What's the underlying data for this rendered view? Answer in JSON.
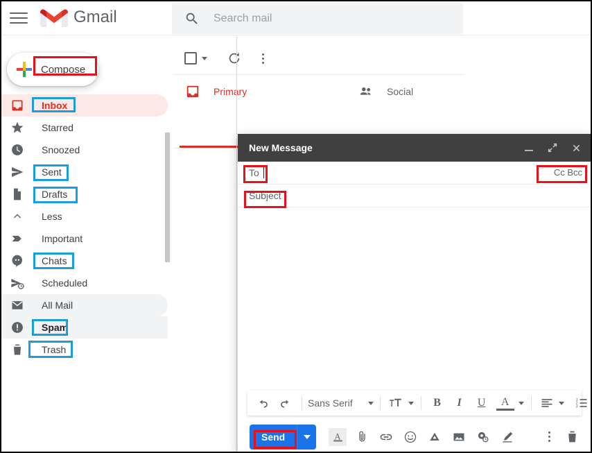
{
  "app": {
    "name": "Gmail",
    "menu_icon": "hamburger-icon",
    "logo_icon": "gmail-logo-icon"
  },
  "search": {
    "placeholder": "Search mail",
    "value": "",
    "icon": "search-icon"
  },
  "sidebar": {
    "compose": {
      "label": "Compose",
      "icon": "plus-icon"
    },
    "items": [
      {
        "label": "Inbox",
        "icon": "inbox-icon",
        "state": "active"
      },
      {
        "label": "Starred",
        "icon": "star-icon",
        "state": "normal"
      },
      {
        "label": "Snoozed",
        "icon": "clock-icon",
        "state": "normal"
      },
      {
        "label": "Sent",
        "icon": "send-icon",
        "state": "normal"
      },
      {
        "label": "Drafts",
        "icon": "draft-icon",
        "state": "normal"
      },
      {
        "label": "Less",
        "icon": "chevron-up-icon",
        "state": "normal"
      },
      {
        "label": "Important",
        "icon": "important-icon",
        "state": "normal"
      },
      {
        "label": "Chats",
        "icon": "chats-icon",
        "state": "normal"
      },
      {
        "label": "Scheduled",
        "icon": "scheduled-icon",
        "state": "normal"
      },
      {
        "label": "All Mail",
        "icon": "all-mail-icon",
        "state": "hovered"
      },
      {
        "label": "Spam",
        "icon": "spam-icon",
        "state": "selected"
      },
      {
        "label": "Trash",
        "icon": "trash-icon",
        "state": "normal"
      }
    ]
  },
  "mail_list": {
    "toolbar": {
      "select_all_icon": "checkbox-icon",
      "select_dropdown_icon": "chevron-down-icon",
      "refresh_icon": "refresh-icon",
      "more_icon": "more-vertical-icon"
    },
    "tabs": [
      {
        "label": "Primary",
        "icon": "inbox-icon",
        "active": true
      },
      {
        "label": "Social",
        "icon": "people-icon",
        "active": false
      }
    ]
  },
  "compose_window": {
    "title": "New Message",
    "controls": {
      "minimize_icon": "minimize-icon",
      "expand_icon": "expand-icon",
      "close_icon": "close-icon"
    },
    "to": {
      "label": "To",
      "value": ""
    },
    "cc_bcc": {
      "label": "Cc Bcc"
    },
    "subject": {
      "label": "Subject",
      "value": ""
    },
    "body": {
      "value": ""
    },
    "format_toolbar": {
      "undo_icon": "undo-icon",
      "redo_icon": "redo-icon",
      "font_family": "Sans Serif",
      "font_dropdown_icon": "chevron-down-icon",
      "font_size_icon": "font-size-icon",
      "font_size_dropdown_icon": "chevron-down-icon",
      "bold_label": "B",
      "italic_label": "I",
      "underline_label": "U",
      "text_color_label": "A",
      "text_color_dropdown_icon": "chevron-down-icon",
      "align_icon": "align-left-icon",
      "align_dropdown_icon": "chevron-down-icon",
      "numbered_list_icon": "numbered-list-icon",
      "more_format_icon": "chevron-down-icon"
    },
    "send_row": {
      "send_label": "Send",
      "send_options_icon": "chevron-down-icon",
      "format_icon": "format-text-icon",
      "attach_icon": "attachment-icon",
      "link_icon": "link-icon",
      "emoji_icon": "emoji-icon",
      "drive_icon": "google-drive-icon",
      "image_icon": "insert-image-icon",
      "confidential_icon": "confidential-mode-icon",
      "signature_icon": "signature-pen-icon",
      "more_options_icon": "more-vertical-icon",
      "discard_icon": "trash-icon"
    }
  },
  "colors": {
    "accent_red": "#d93025",
    "send_blue": "#1a73e8",
    "annotation_blue": "#1a9ee0",
    "annotation_red": "#e8101b",
    "header_dark": "#404040",
    "inbox_highlight": "#fce8e6"
  }
}
